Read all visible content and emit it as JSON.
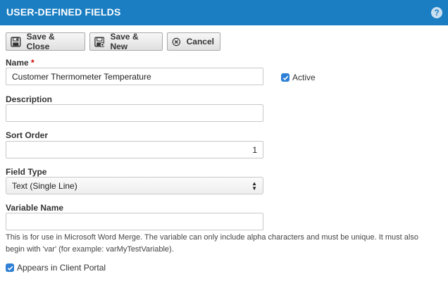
{
  "header": {
    "title": "USER-DEFINED FIELDS",
    "help_icon": "question-circle-icon",
    "help_glyph": "?"
  },
  "toolbar": {
    "save_close_label": "Save & Close",
    "save_new_label": "Save & New",
    "cancel_label": "Cancel"
  },
  "form": {
    "name": {
      "label": "Name",
      "required_mark": "*",
      "value": "Customer Thermometer Temperature"
    },
    "active": {
      "label": "Active",
      "checked": true
    },
    "description": {
      "label": "Description",
      "value": ""
    },
    "sort_order": {
      "label": "Sort Order",
      "value": "1"
    },
    "field_type": {
      "label": "Field Type",
      "selected": "Text (Single Line)"
    },
    "variable_name": {
      "label": "Variable Name",
      "value": "",
      "help_text": "This is for use in Microsoft Word Merge. The variable can only include alpha characters and must be unique. It must also begin with 'var' (for example: varMyTestVariable)."
    },
    "client_portal": {
      "label": "Appears in Client Portal",
      "checked": true
    }
  },
  "colors": {
    "header_bg": "#1b7ec2",
    "checkbox": "#2e7fd6",
    "required": "#cc0000"
  }
}
